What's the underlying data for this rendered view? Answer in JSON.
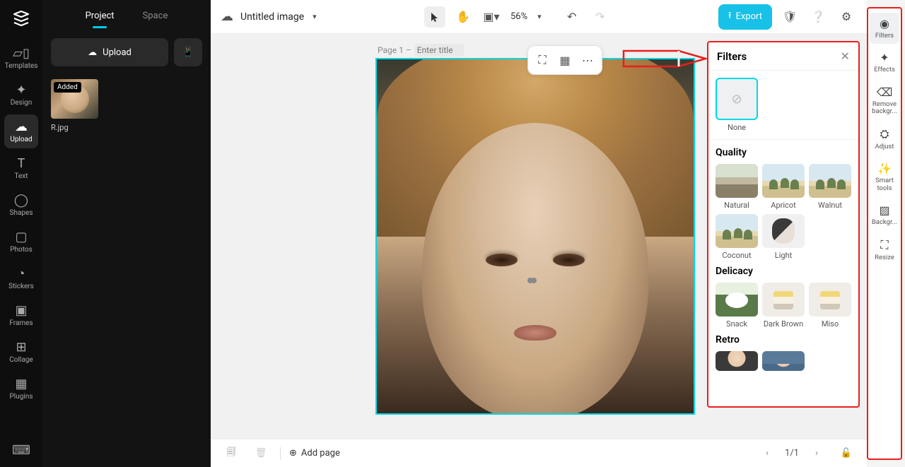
{
  "leftRail": [
    {
      "id": "templates",
      "label": "Templates"
    },
    {
      "id": "design",
      "label": "Design"
    },
    {
      "id": "upload",
      "label": "Upload",
      "active": true
    },
    {
      "id": "text",
      "label": "Text"
    },
    {
      "id": "shapes",
      "label": "Shapes"
    },
    {
      "id": "photos",
      "label": "Photos"
    },
    {
      "id": "stickers",
      "label": "Stickers"
    },
    {
      "id": "frames",
      "label": "Frames"
    },
    {
      "id": "collage",
      "label": "Collage"
    },
    {
      "id": "plugins",
      "label": "Plugins"
    }
  ],
  "sideTabs": {
    "project": "Project",
    "space": "Space"
  },
  "uploadBtn": "Upload",
  "media": {
    "badge": "Added",
    "name": "R.jpg"
  },
  "docTitle": "Untitled image",
  "zoom": "56%",
  "exportLabel": "Export",
  "pageLabel": "Page 1 –",
  "pageTitlePlaceholder": "Enter title",
  "addPage": "Add page",
  "pageCounter": "1/1",
  "filtersPanel": {
    "title": "Filters",
    "none": "None",
    "sections": [
      {
        "title": "Quality",
        "items": [
          "Natural",
          "Apricot",
          "Walnut",
          "Coconut",
          "Light"
        ]
      },
      {
        "title": "Delicacy",
        "items": [
          "Snack",
          "Dark Brown",
          "Miso"
        ]
      },
      {
        "title": "Retro",
        "items": [
          "",
          ""
        ]
      }
    ]
  },
  "rightRail": [
    {
      "id": "filters",
      "label": "Filters",
      "active": true
    },
    {
      "id": "effects",
      "label": "Effects"
    },
    {
      "id": "removebg",
      "label": "Remove backgr..."
    },
    {
      "id": "adjust",
      "label": "Adjust"
    },
    {
      "id": "smart",
      "label": "Smart tools"
    },
    {
      "id": "backgr",
      "label": "Backgr..."
    },
    {
      "id": "resize",
      "label": "Resize"
    }
  ]
}
